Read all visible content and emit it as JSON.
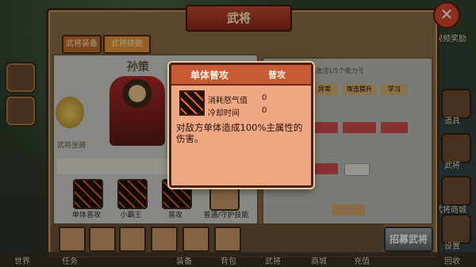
{
  "window": {
    "title": "武将",
    "close_glyph": "✕"
  },
  "tabs": [
    {
      "label": "武将装备"
    },
    {
      "label": "武将技能"
    }
  ],
  "hero": {
    "name": "孙策",
    "pet_label": "武将坐骑"
  },
  "right_panel": {
    "header": "已激活1/5个能力号",
    "buttons": [
      "异常",
      "攻击提升",
      "学习"
    ]
  },
  "skills": [
    {
      "label": "单体普攻"
    },
    {
      "label": "小霸王"
    },
    {
      "label": "普攻"
    },
    {
      "label": "普通/守护技能"
    }
  ],
  "recruit_label": "招募武将",
  "right_menu": [
    "视频奖励",
    "道具",
    "武将",
    "武将商城",
    "设置"
  ],
  "bottom_nav": [
    "世界",
    "任务",
    "装备",
    "背包",
    "武将",
    "商城",
    "充值",
    "回收"
  ],
  "modal": {
    "title": "单体普攻",
    "type": "普攻",
    "rows": [
      {
        "label": "消耗怒气值",
        "value": "0"
      },
      {
        "label": "冷却时间",
        "value": "0"
      }
    ],
    "description": "对敌方单体造成100%主属性的伤害。"
  }
}
